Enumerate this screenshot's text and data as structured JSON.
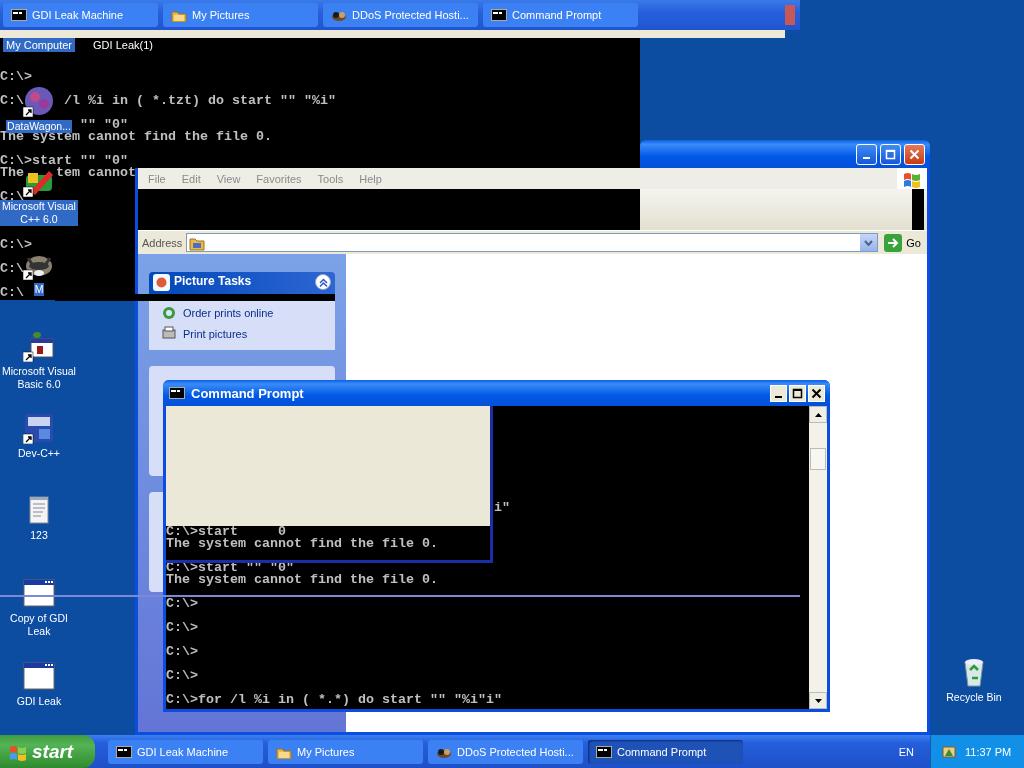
{
  "ghost_taskbar": {
    "buttons": [
      {
        "label": "GDI Leak Machine"
      },
      {
        "label": "My Pictures"
      },
      {
        "label": "DDoS Protected Hosti..."
      },
      {
        "label": "Command Prompt"
      }
    ]
  },
  "ghost_labels": [
    {
      "label": "My Computer",
      "selected": true
    },
    {
      "label": "GDI Leak(1)",
      "selected": false
    }
  ],
  "background_console": {
    "lines": [
      {
        "segments": [
          "C:\\>"
        ]
      },
      {
        "segments": [
          "C:\\",
          "/l %i in ( *.tzt) do start \"\" \"%i\""
        ]
      },
      {
        "segments": [
          "\"\" \"0\""
        ]
      },
      {
        "segments": [
          "The system cannot find the file 0."
        ]
      },
      {
        "segments": [
          "C:\\>start \"\" \"0\""
        ]
      },
      {
        "segments": [
          "The",
          "tem cannot"
        ]
      },
      {
        "segments": [
          "C:\\"
        ]
      },
      {
        "segments": [
          "C:\\>"
        ]
      },
      {
        "segments": [
          "C:\\"
        ]
      },
      {
        "segments": [
          "C:\\"
        ]
      }
    ]
  },
  "explorer": {
    "menu": [
      "File",
      "Edit",
      "View",
      "Favorites",
      "Tools",
      "Help"
    ],
    "address_label": "Address",
    "go_button": "Go",
    "task_group": {
      "title": "Picture Tasks",
      "links": [
        "Order prints online",
        "Print pictures"
      ]
    }
  },
  "desktop_icons": [
    {
      "label": "DataWagon...",
      "selected": true
    },
    {
      "label": "Microsoft Visual C++ 6.0",
      "selected": true
    },
    {
      "label": "M",
      "selected": true
    },
    {
      "label": "Microsoft Visual Basic 6.0",
      "selected": false
    },
    {
      "label": "Dev-C++",
      "selected": false
    },
    {
      "label": "123",
      "selected": false
    },
    {
      "label": "Copy of GDI Leak",
      "selected": false
    },
    {
      "label": "GDI Leak",
      "selected": false
    },
    {
      "label": "Recycle Bin",
      "selected": false
    }
  ],
  "command_prompt": {
    "title": "Command Prompt",
    "lines": [
      {
        "segments": [
          "i\""
        ]
      },
      {
        "segments": [
          "C:\\>start",
          "0"
        ]
      },
      {
        "segments": [
          "The system cannot find the file 0."
        ]
      },
      {
        "segments": [
          "C:\\>start \"\" \"0\""
        ]
      },
      {
        "segments": [
          "The system cannot find the file 0."
        ]
      },
      {
        "segments": [
          "C:\\>"
        ]
      },
      {
        "segments": [
          "C:\\>"
        ]
      },
      {
        "segments": [
          "C:\\>"
        ]
      },
      {
        "segments": [
          "C:\\>"
        ]
      },
      {
        "segments": [
          "C:\\>for /l %i in ( *.*) do start \"\" \"%i\"i\""
        ]
      }
    ]
  },
  "taskbar": {
    "start": "start",
    "buttons": [
      {
        "label": "GDI Leak Machine",
        "selected": false
      },
      {
        "label": "My Pictures",
        "selected": false
      },
      {
        "label": "DDoS Protected Hosti...",
        "selected": false
      },
      {
        "label": "Command Prompt",
        "selected": true
      }
    ],
    "language": "EN",
    "clock": "11:37 PM"
  }
}
